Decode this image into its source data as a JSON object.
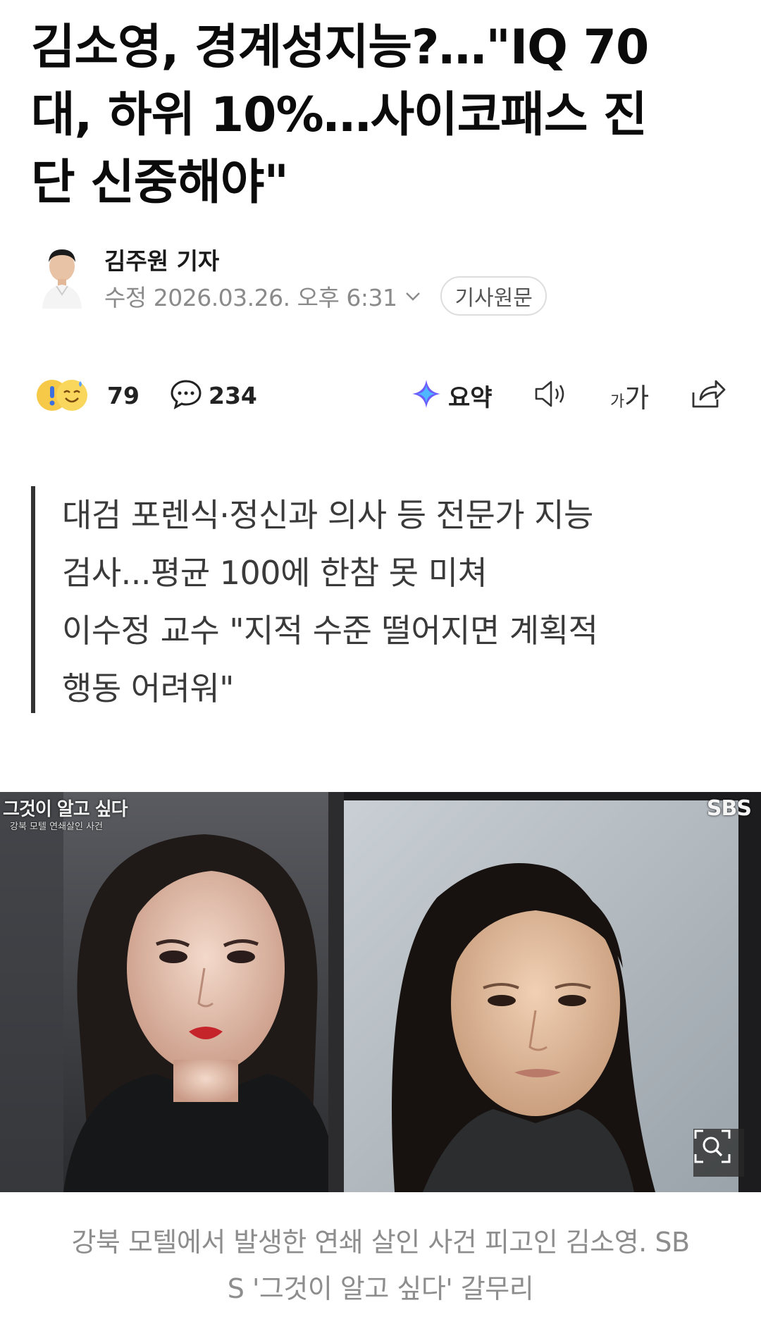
{
  "article": {
    "headline_line1": "김소영, 경계성지능?…\"IQ 70",
    "headline_line2": "대, 하위 10%…사이코패스 진",
    "headline_line3": "단 신중해야\""
  },
  "byline": {
    "reporter": "김주원 기자",
    "date": "수정 2026.03.26. 오후 6:31",
    "origin_button": "기사원문"
  },
  "actions": {
    "reactions_count": "79",
    "comments_count": "234",
    "summary_label": "요약",
    "font_size_label_small": "가",
    "font_size_label_large": "가"
  },
  "summary": {
    "line1": "대검 포렌식·정신과 의사 등 전문가 지능",
    "line2": "검사...평균 100에 한참 못 미쳐",
    "line3": "이수정 교수 \"지적 수준 떨어지면 계획적",
    "line4": "행동 어려워\""
  },
  "photo": {
    "program_title": "그것이 알고 싶다",
    "program_subtitle": "강북 모텔 연쇄살인 사건",
    "broadcaster": "SBS"
  },
  "caption": {
    "line1": "강북 모텔에서 발생한 연쇄 살인 사건 피고인 김소영. SB",
    "line2": "S '그것이 알고 싶다' 갈무리"
  },
  "icons": {
    "chevron": "chevron-down-icon",
    "comment": "comment-icon",
    "summary": "sparkle-icon",
    "tts": "speaker-icon",
    "share": "share-icon",
    "zoom": "zoom-icon"
  },
  "colors": {
    "text": "#111111",
    "meta_gray": "#8a8a8a",
    "summary_bar": "#333333",
    "caption_gray": "#8d8d8d"
  }
}
